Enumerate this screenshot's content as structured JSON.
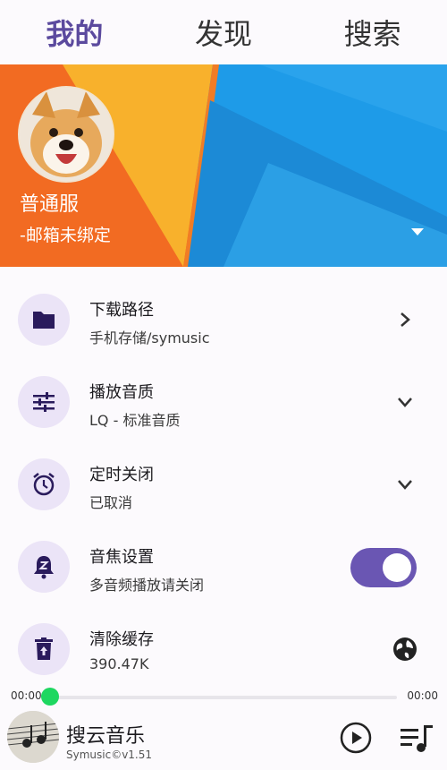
{
  "tabs": [
    {
      "label": "我的",
      "active": true
    },
    {
      "label": "发现",
      "active": false
    },
    {
      "label": "搜索",
      "active": false
    }
  ],
  "profile": {
    "name": "普通服",
    "email": "-邮箱未绑定"
  },
  "settings": [
    {
      "title": "下载路径",
      "subtitle": "手机存储/symusic",
      "icon": "folder-icon",
      "trailing": "chevron-right-icon"
    },
    {
      "title": "播放音质",
      "subtitle": "LQ - 标准音质",
      "icon": "tune-icon",
      "trailing": "chevron-down-icon"
    },
    {
      "title": "定时关闭",
      "subtitle": "已取消",
      "icon": "alarm-icon",
      "trailing": "chevron-down-icon"
    },
    {
      "title": "音焦设置",
      "subtitle": "多音频播放请关闭",
      "icon": "bell-z-icon",
      "trailing": "toggle",
      "toggle_on": true
    },
    {
      "title": "清除缓存",
      "subtitle": "390.47K",
      "icon": "trash-icon",
      "trailing": "globe-icon"
    }
  ],
  "progress": {
    "current": "00:00",
    "total": "00:00"
  },
  "player": {
    "title": "搜云音乐",
    "subtitle": "Symusic©v1.51"
  },
  "colors": {
    "accent": "#6a56b3",
    "icon_bg": "#ebe4f7",
    "progress_thumb": "#1ed760",
    "banner_orange": "#f26b22",
    "banner_yellow": "#f8b12c",
    "banner_blue": "#1e9be8"
  }
}
